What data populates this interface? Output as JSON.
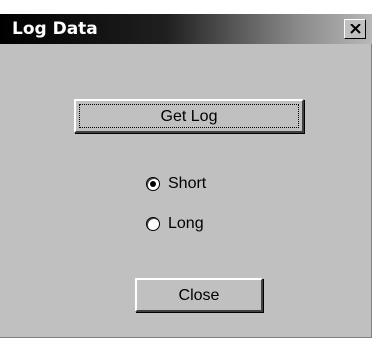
{
  "window": {
    "title": "Log Data"
  },
  "buttons": {
    "get_log": "Get Log",
    "close": "Close"
  },
  "radio_options": [
    {
      "label": "Short",
      "checked": true
    },
    {
      "label": "Long",
      "checked": false
    }
  ],
  "colors": {
    "dialog_bg": "#c0c0c0",
    "titlebar_start": "#000000",
    "titlebar_end": "#b8b8b8",
    "title_text": "#ffffff"
  },
  "icons": {
    "close": "close-icon"
  }
}
